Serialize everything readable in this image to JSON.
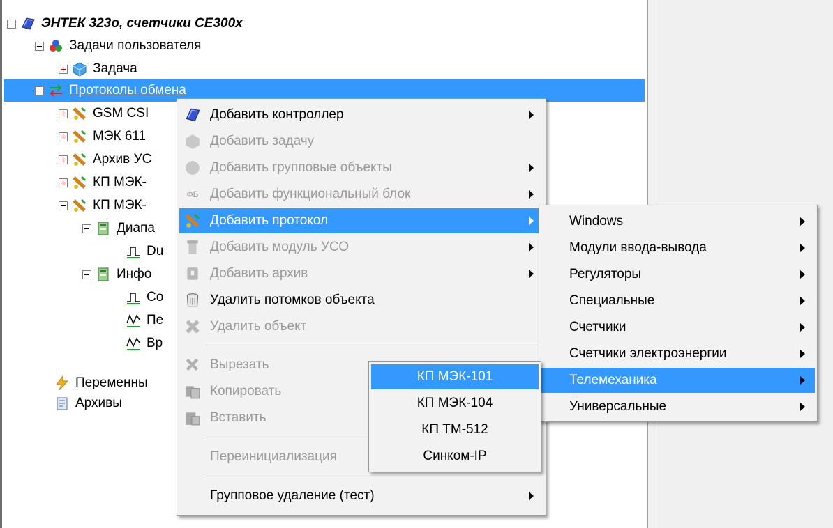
{
  "tree": {
    "root_label": "ЭНТЕК 323о, счетчики CE300x",
    "user_tasks_label": "Задачи пользователя",
    "task_label": "Задача",
    "protocols_label": "Протоколы обмена",
    "proto_items": [
      "GSM CSI",
      "МЭК 611",
      "Архив УС",
      "КП МЭК-",
      "КП МЭК-"
    ],
    "range_label": "Диапа",
    "du_label": "Du",
    "info_label": "Инфо",
    "co_label": "Co",
    "pe_label": "Пе",
    "vr_label": "Вр",
    "variables_label": "Переменны",
    "archives_label": "Архивы"
  },
  "context_menu": {
    "items": [
      {
        "label": "Добавить контроллер",
        "enabled": true,
        "submenu": true,
        "icon": "controller-icon"
      },
      {
        "label": "Добавить задачу",
        "enabled": false,
        "submenu": false,
        "icon": "task-icon"
      },
      {
        "label": "Добавить групповые объекты",
        "enabled": false,
        "submenu": true,
        "icon": "group-objects-icon"
      },
      {
        "label": "Добавить функциональный блок",
        "enabled": false,
        "submenu": true,
        "icon": "function-block-icon",
        "icon_text": "ФБ"
      },
      {
        "label": "Добавить протокол",
        "enabled": true,
        "submenu": true,
        "icon": "protocol-icon",
        "highlighted": true
      },
      {
        "label": "Добавить модуль УСО",
        "enabled": false,
        "submenu": true,
        "icon": "uso-module-icon"
      },
      {
        "label": "Добавить архив",
        "enabled": false,
        "submenu": true,
        "icon": "archive-icon"
      },
      {
        "label": "Удалить потомков объекта",
        "enabled": true,
        "submenu": false,
        "icon": "delete-children-icon"
      },
      {
        "label": "Удалить объект",
        "enabled": false,
        "submenu": false,
        "icon": "delete-object-icon"
      },
      {
        "label": "Вырезать",
        "enabled": false,
        "submenu": false,
        "icon": "cut-icon"
      },
      {
        "label": "Копировать",
        "enabled": false,
        "submenu": false,
        "icon": "copy-icon"
      },
      {
        "label": "Вставить",
        "enabled": false,
        "submenu": false,
        "icon": "paste-icon"
      },
      {
        "label": "Переинициализация",
        "enabled": false,
        "submenu": false,
        "icon": ""
      },
      {
        "label": "Групповое удаление (тест)",
        "enabled": true,
        "submenu": true,
        "icon": ""
      }
    ]
  },
  "protocol_submenu": {
    "items": [
      "Windows",
      "Модули ввода-вывода",
      "Регуляторы",
      "Специальные",
      "Счетчики",
      "Счетчики электроэнергии",
      "Телемеханика",
      "Универсальные"
    ],
    "highlighted": "Телемеханика"
  },
  "telemechanics_submenu": {
    "items": [
      "КП МЭК-101",
      "КП МЭК-104",
      "КП ТМ-512",
      "Синком-IP"
    ],
    "highlighted": "КП МЭК-101"
  },
  "colors": {
    "selection": "#3399ff",
    "menu_bg": "#f2f2f2",
    "disabled_text": "#9a9a9a",
    "panel_bg": "#f0f0f0"
  }
}
